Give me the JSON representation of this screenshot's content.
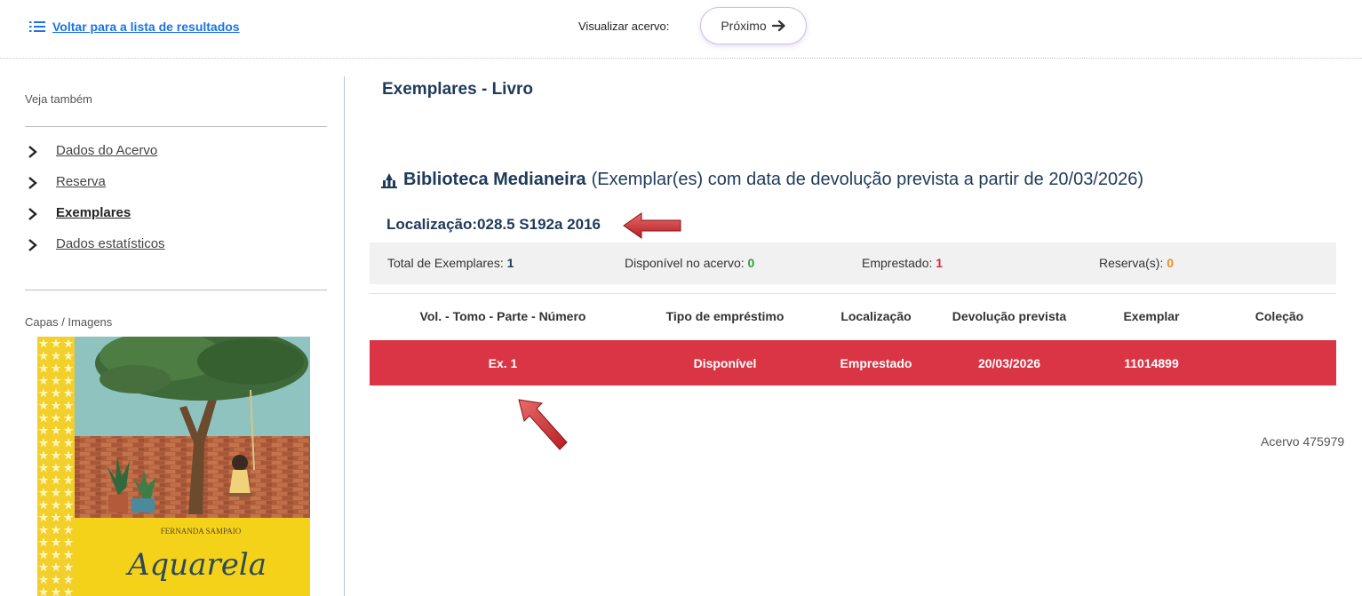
{
  "topbar": {
    "back_label": "Voltar para a lista de resultados",
    "view_label": "Visualizar acervo:",
    "next_label": "Próximo"
  },
  "sidebar": {
    "see_also": "Veja também",
    "items": [
      {
        "label": "Dados do Acervo",
        "active": false
      },
      {
        "label": "Reserva",
        "active": false
      },
      {
        "label": "Exemplares",
        "active": true
      },
      {
        "label": "Dados estatísticos",
        "active": false
      }
    ],
    "covers_label": "Capas / Imagens",
    "cover": {
      "author": "FERNANDA SAMPAIO",
      "title": "Aquarela"
    }
  },
  "main": {
    "title": "Exemplares - Livro",
    "library_name": "Biblioteca Medianeira",
    "library_note": "(Exemplar(es) com data de devolução prevista a partir de 20/03/2026)",
    "location": "Localização:028.5 S192a 2016",
    "summary": {
      "total_label": "Total de Exemplares:",
      "total_value": "1",
      "available_label": "Disponível no acervo:",
      "available_value": "0",
      "loaned_label": "Emprestado:",
      "loaned_value": "1",
      "reserve_label": "Reserva(s):",
      "reserve_value": "0"
    },
    "table": {
      "headers": [
        "Vol. - Tomo - Parte - Número",
        "Tipo de empréstimo",
        "Localização",
        "Devolução prevista",
        "Exemplar",
        "Coleção"
      ],
      "rows": [
        [
          "Ex. 1",
          "Disponível",
          "Emprestado",
          "20/03/2026",
          "11014899",
          ""
        ]
      ]
    },
    "acervo": "Acervo 475979"
  },
  "colors": {
    "highlight_row": "#d93545",
    "heading": "#1f3a5a",
    "link": "#1a73e8",
    "green": "#2e9e3e",
    "red": "#d32f3f",
    "orange": "#f08a24"
  }
}
